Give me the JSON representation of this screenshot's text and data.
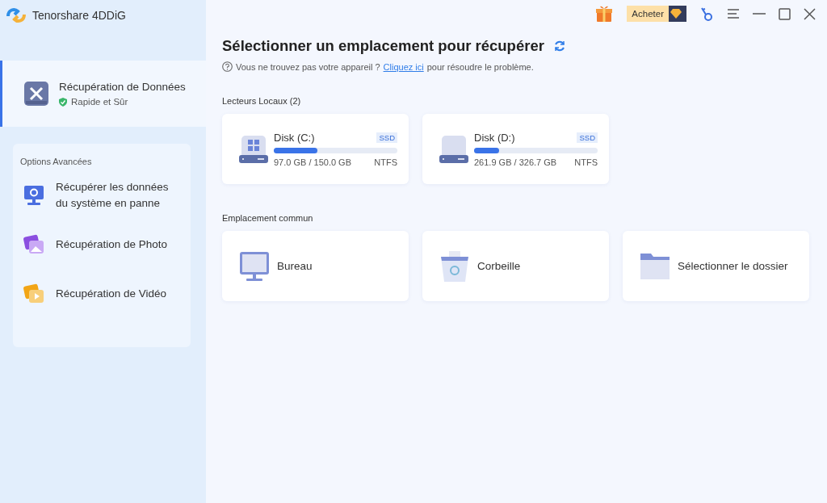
{
  "app": {
    "title": "Tenorshare 4DDiG"
  },
  "sidebar": {
    "items": [
      {
        "label": "Récupération de Données",
        "sub": "Rapide et Sûr",
        "selected": true,
        "kind": "tools"
      }
    ],
    "advanced": {
      "title": "Options Avancées",
      "items": [
        {
          "label": "Récupérer les données du système en panne",
          "kind": "monitor"
        },
        {
          "label": "Récupération de Photo",
          "kind": "photo"
        },
        {
          "label": "Récupération de Vidéo",
          "kind": "video"
        }
      ]
    }
  },
  "toolbar": {
    "buy": "Acheter"
  },
  "main": {
    "title": "Sélectionner un emplacement pour récupérer",
    "help_before": "Vous ne trouvez pas votre appareil ?",
    "help_link": "Cliquez ici",
    "help_after": "pour résoudre le problème.",
    "local_title": "Lecteurs Locaux (2)",
    "drives": [
      {
        "name": "Disk (C:)",
        "badge": "SSD",
        "level": 0.35,
        "size": "97.0 GB / 150.0 GB",
        "fs": "NTFS",
        "kind": "system"
      },
      {
        "name": "Disk (D:)",
        "badge": "SSD",
        "level": 0.2,
        "size": "261.9 GB / 326.7 GB",
        "fs": "NTFS",
        "kind": "data"
      }
    ],
    "common_title": "Emplacement commun",
    "locations": [
      {
        "label": "Bureau",
        "kind": "desktop"
      },
      {
        "label": "Corbeille",
        "kind": "bin"
      },
      {
        "label": "Sélectionner le dossier",
        "kind": "folder"
      }
    ]
  }
}
